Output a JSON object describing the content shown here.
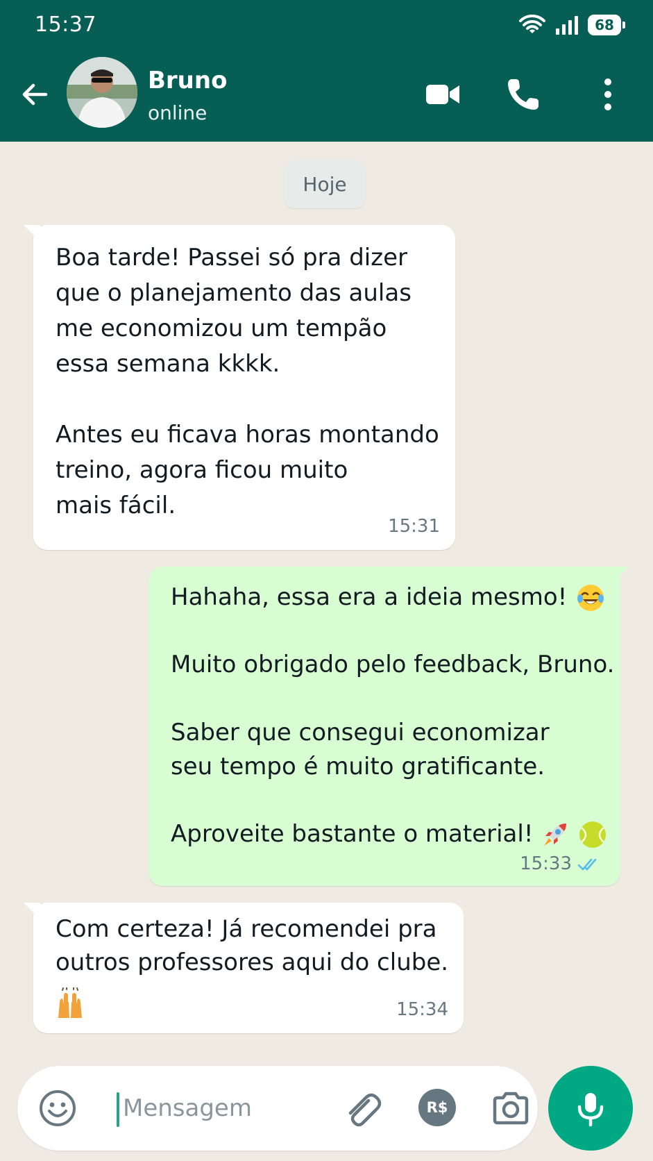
{
  "status_bar": {
    "time": "15:37",
    "battery": "68"
  },
  "header": {
    "contact_name": "Bruno",
    "contact_status": "online"
  },
  "date_separator": "Hoje",
  "messages": [
    {
      "direction": "incoming",
      "text": "Boa tarde! Passei só pra dizer\nque o planejamento das aulas\nme economizou um tempão\nessa semana kkkk.\n\nAntes eu ficava horas montando\ntreino, agora ficou muito\nmais fácil.",
      "time": "15:31"
    },
    {
      "direction": "outgoing",
      "paragraphs": [
        "Hahaha, essa era a ideia mesmo!",
        "Muito obrigado pelo feedback, Bruno.",
        "Saber que consegui economizar\nseu tempo é muito gratificante.",
        "Aproveite bastante o material!"
      ],
      "emojis": [
        "laughing-tears-emoji",
        "rocket-emoji",
        "tennis-ball-emoji"
      ],
      "time": "15:33",
      "read_receipt": "double-check-blue"
    },
    {
      "direction": "incoming",
      "text": "Com certeza! Já recomendei pra\noutros professores aqui do clube.",
      "emojis": [
        "raising-hands-emoji"
      ],
      "time": "15:34"
    }
  ],
  "composer": {
    "placeholder": "Mensagem",
    "pay_label": "R$"
  },
  "colors": {
    "header": "#075e54",
    "chat_background": "#efeae2",
    "incoming_bubble": "#ffffff",
    "outgoing_bubble": "#d9fdd3",
    "accent": "#00a884",
    "read_tick": "#53bdeb"
  }
}
